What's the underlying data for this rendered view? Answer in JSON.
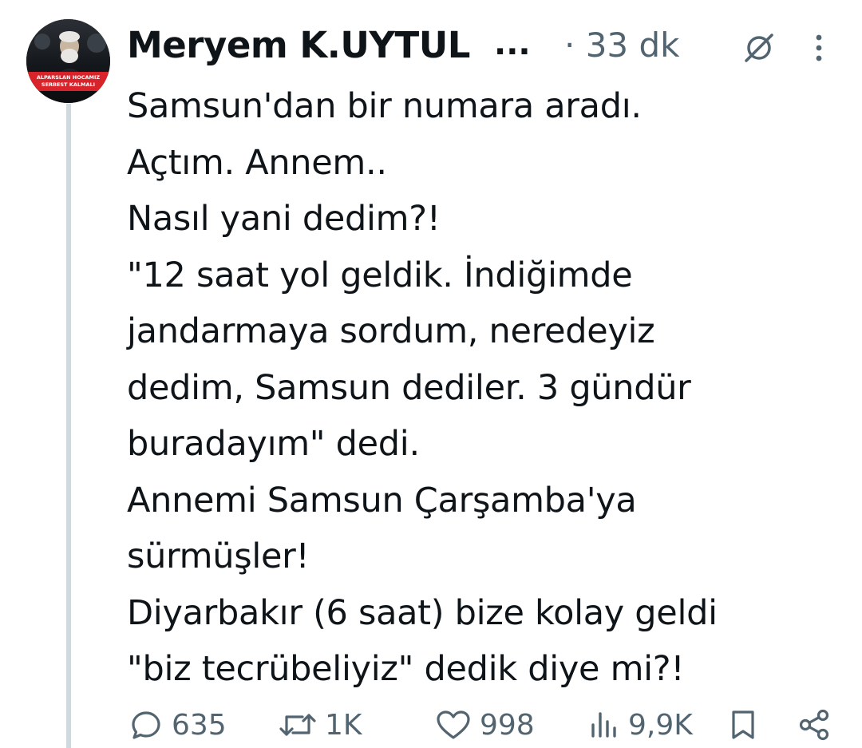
{
  "author": {
    "name": "Meryem K.UYTUL",
    "name_truncation": "...",
    "time": "· 33 dk",
    "avatar_text_line1": "ALPARSLAN HOCAMIZ",
    "avatar_text_line2": "SERBEST KALMALI"
  },
  "tweet": {
    "lines": [
      "Samsun'dan bir numara aradı.",
      "Açtım. Annem..",
      "Nasıl yani dedim?!",
      "\"12 saat yol geldik. İndiğimde",
      "jandarmaya sordum, neredeyiz",
      "dedim, Samsun dediler. 3 gündür",
      "buradayım\" dedi.",
      "Annemi Samsun Çarşamba'ya",
      "sürmüşler!",
      "Diyarbakır (6 saat) bize kolay geldi",
      "\"biz tecrübeliyiz\" dedik diye mi?!"
    ]
  },
  "actions": {
    "replies": "635",
    "reposts": "1K",
    "likes": "998",
    "views": "9,9K"
  },
  "icons": {
    "reply": "reply-icon",
    "repost": "repost-icon",
    "like": "heart-icon",
    "views": "views-icon",
    "bookmark": "bookmark-icon",
    "share": "share-icon",
    "grok": "grok-icon",
    "more": "more-icon"
  },
  "colors": {
    "text": "#0f1419",
    "secondary": "#536471",
    "thread_line": "#cfd9de",
    "avatar_banner": "#d8232a"
  }
}
